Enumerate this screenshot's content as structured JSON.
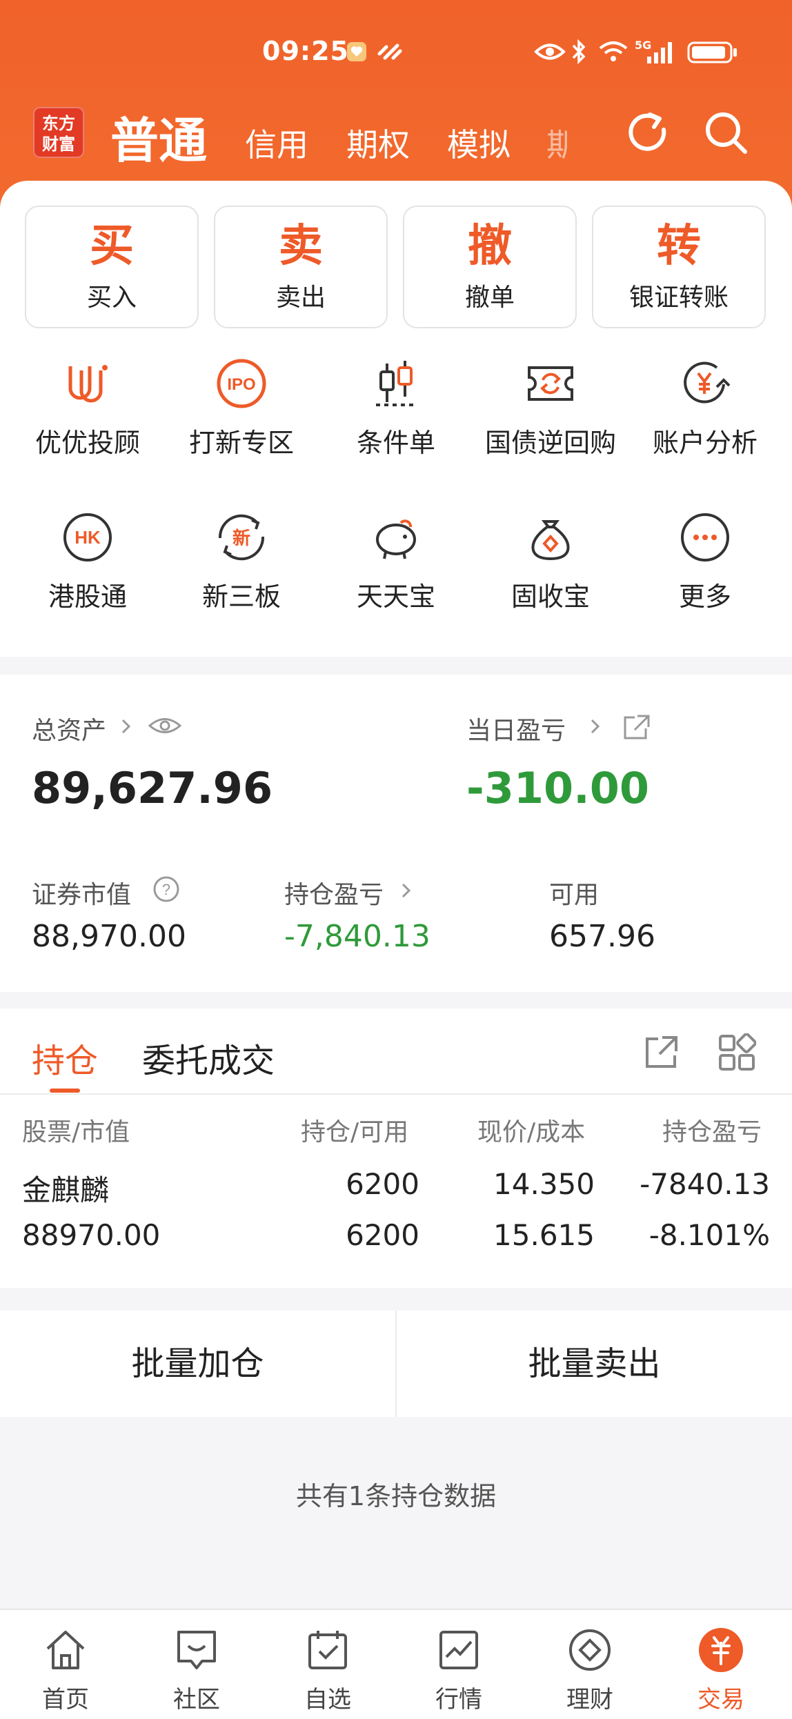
{
  "status_bar": {
    "time": "09:25",
    "network": "5G"
  },
  "header": {
    "logo_text": "东方财富",
    "tabs": [
      {
        "label": "普通"
      },
      {
        "label": "信用"
      },
      {
        "label": "期权"
      },
      {
        "label": "模拟"
      },
      {
        "label": "期"
      }
    ],
    "icons": [
      "refresh-icon",
      "search-icon"
    ]
  },
  "quick_actions": [
    {
      "big": "买",
      "label": "买入"
    },
    {
      "big": "卖",
      "label": "卖出"
    },
    {
      "big": "撤",
      "label": "撤单"
    },
    {
      "big": "转",
      "label": "银证转账"
    }
  ],
  "features": [
    {
      "label": "优优投顾",
      "icon": "youyou-icon"
    },
    {
      "label": "打新专区",
      "icon": "ipo-icon"
    },
    {
      "label": "条件单",
      "icon": "candlestick-icon"
    },
    {
      "label": "国债逆回购",
      "icon": "ticket-icon"
    },
    {
      "label": "账户分析",
      "icon": "yuan-chart-icon"
    },
    {
      "label": "港股通",
      "icon": "hk-icon"
    },
    {
      "label": "新三板",
      "icon": "xin-icon"
    },
    {
      "label": "天天宝",
      "icon": "piggy-icon"
    },
    {
      "label": "固收宝",
      "icon": "moneybag-icon"
    },
    {
      "label": "更多",
      "icon": "more-icon"
    }
  ],
  "assets": {
    "total_label": "总资产",
    "total_value": "89,627.96",
    "daily_label": "当日盈亏",
    "daily_value": "-310.00",
    "market_value_label": "证券市值",
    "market_value": "88,970.00",
    "position_pl_label": "持仓盈亏",
    "position_pl": "-7,840.13",
    "available_label": "可用",
    "available": "657.96",
    "colors": {
      "loss": "#2f9a3a",
      "accent": "#ee5a28"
    }
  },
  "holdings": {
    "tabs": [
      "持仓",
      "委托成交"
    ],
    "columns": [
      "股票/市值",
      "持仓/可用",
      "现价/成本",
      "持仓盈亏"
    ],
    "rows": [
      {
        "name": "金麒麟",
        "market_value": "88970.00",
        "position": "6200",
        "available": "6200",
        "price": "14.350",
        "cost": "15.615",
        "pl": "-7840.13",
        "pl_pct": "-8.101%"
      }
    ]
  },
  "batch": {
    "add_label": "批量加仓",
    "sell_label": "批量卖出"
  },
  "empty_note": "共有1条持仓数据",
  "bottom_nav": [
    {
      "label": "首页",
      "icon": "home-icon"
    },
    {
      "label": "社区",
      "icon": "community-icon"
    },
    {
      "label": "自选",
      "icon": "watchlist-icon"
    },
    {
      "label": "行情",
      "icon": "market-icon"
    },
    {
      "label": "理财",
      "icon": "wealth-icon"
    },
    {
      "label": "交易",
      "icon": "trade-icon",
      "active": true
    }
  ]
}
